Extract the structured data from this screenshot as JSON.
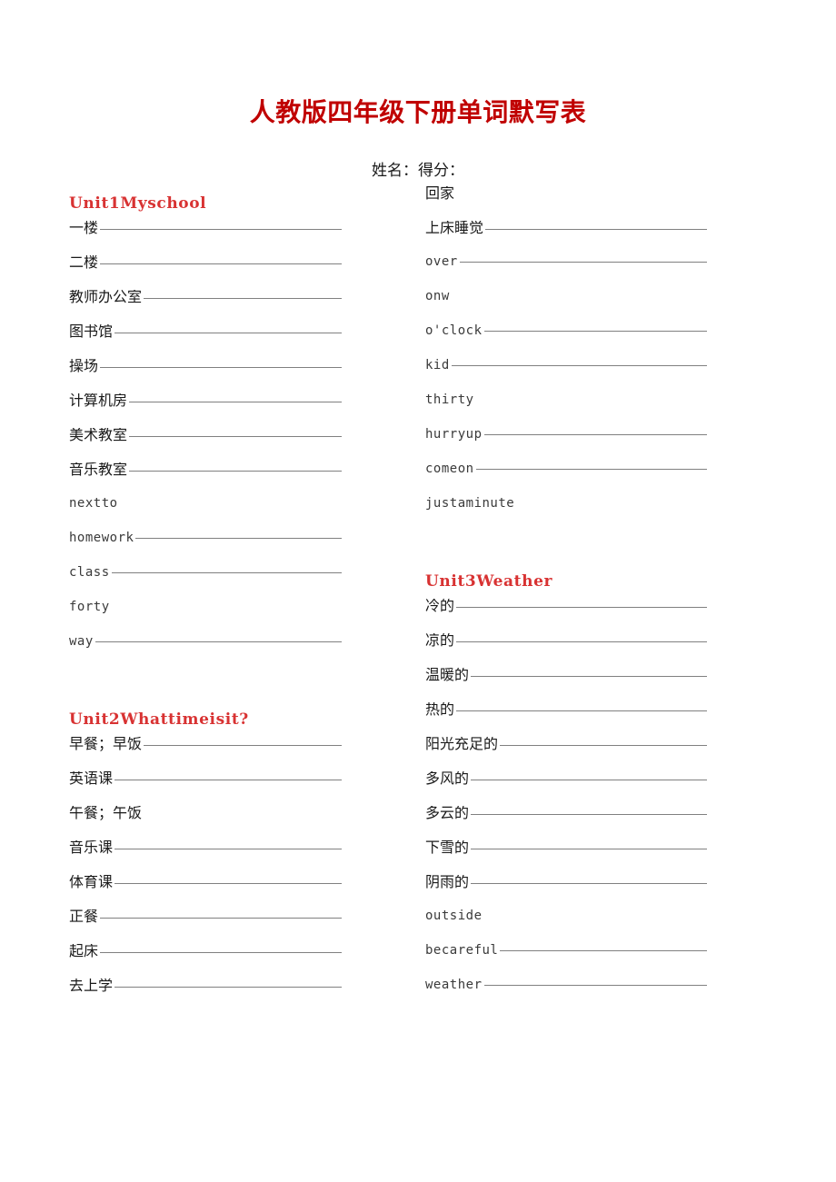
{
  "document": {
    "title": "人教版四年级下册单词默写表",
    "name_score_line": "姓名：得分：",
    "title_color": "#c00000",
    "unit_heading_color": "#d83232",
    "rule_color": "#808080"
  },
  "columns": {
    "left": {
      "sections": [
        {
          "heading": "Unit1Myschool",
          "rows": [
            {
              "label": "一楼",
              "lang": "cn",
              "rule": true
            },
            {
              "label": "二楼",
              "lang": "cn",
              "rule": true
            },
            {
              "label": "教师办公室",
              "lang": "cn",
              "rule": true
            },
            {
              "label": "图书馆",
              "lang": "cn",
              "rule": true
            },
            {
              "label": "操场",
              "lang": "cn",
              "rule": true
            },
            {
              "label": "计算机房",
              "lang": "cn",
              "rule": true
            },
            {
              "label": "美术教室",
              "lang": "cn",
              "rule": true
            },
            {
              "label": "音乐教室",
              "lang": "cn",
              "rule": true
            },
            {
              "label": "nextto",
              "lang": "en",
              "rule": false
            },
            {
              "label": "homework",
              "lang": "en",
              "rule": true
            },
            {
              "label": "class",
              "lang": "en",
              "rule": true
            },
            {
              "label": "forty",
              "lang": "en",
              "rule": false
            },
            {
              "label": "way",
              "lang": "en",
              "rule": true
            }
          ]
        },
        {
          "heading": "Unit2Whattimeisit?",
          "rows": [
            {
              "label": "早餐；早饭",
              "lang": "cn",
              "rule": true
            },
            {
              "label": "英语课",
              "lang": "cn",
              "rule": true
            },
            {
              "label": "午餐；午饭",
              "lang": "cn",
              "rule": false
            },
            {
              "label": "音乐课",
              "lang": "cn",
              "rule": true
            },
            {
              "label": "体育课",
              "lang": "cn",
              "rule": true
            },
            {
              "label": "正餐",
              "lang": "cn",
              "rule": true
            },
            {
              "label": "起床",
              "lang": "cn",
              "rule": true
            },
            {
              "label": "去上学",
              "lang": "cn",
              "rule": true
            }
          ]
        }
      ]
    },
    "right": {
      "sections": [
        {
          "heading": "",
          "rows": [
            {
              "label": "回家",
              "lang": "cn",
              "rule": false
            },
            {
              "label": "上床睡觉",
              "lang": "cn",
              "rule": true
            },
            {
              "label": "over",
              "lang": "en",
              "rule": true
            },
            {
              "label": "onw",
              "lang": "en",
              "rule": false
            },
            {
              "label": "o'clock",
              "lang": "en",
              "rule": true
            },
            {
              "label": "kid",
              "lang": "en",
              "rule": true
            },
            {
              "label": "thirty",
              "lang": "en",
              "rule": false
            },
            {
              "label": "hurryup",
              "lang": "en",
              "rule": true
            },
            {
              "label": "comeon",
              "lang": "en",
              "rule": true
            },
            {
              "label": "justaminute",
              "lang": "en",
              "rule": false
            }
          ]
        },
        {
          "heading": "Unit3Weather",
          "rows": [
            {
              "label": "冷的",
              "lang": "cn",
              "rule": true
            },
            {
              "label": "凉的",
              "lang": "cn",
              "rule": true
            },
            {
              "label": "温暖的",
              "lang": "cn",
              "rule": true
            },
            {
              "label": "热的",
              "lang": "cn",
              "rule": true
            },
            {
              "label": "阳光充足的",
              "lang": "cn",
              "rule": true
            },
            {
              "label": "多风的",
              "lang": "cn",
              "rule": true
            },
            {
              "label": "多云的",
              "lang": "cn",
              "rule": true
            },
            {
              "label": "下雪的",
              "lang": "cn",
              "rule": true
            },
            {
              "label": "阴雨的",
              "lang": "cn",
              "rule": true
            },
            {
              "label": "outside",
              "lang": "en",
              "rule": false
            },
            {
              "label": "becareful",
              "lang": "en",
              "rule": true
            },
            {
              "label": "weather",
              "lang": "en",
              "rule": true
            }
          ]
        }
      ]
    }
  }
}
